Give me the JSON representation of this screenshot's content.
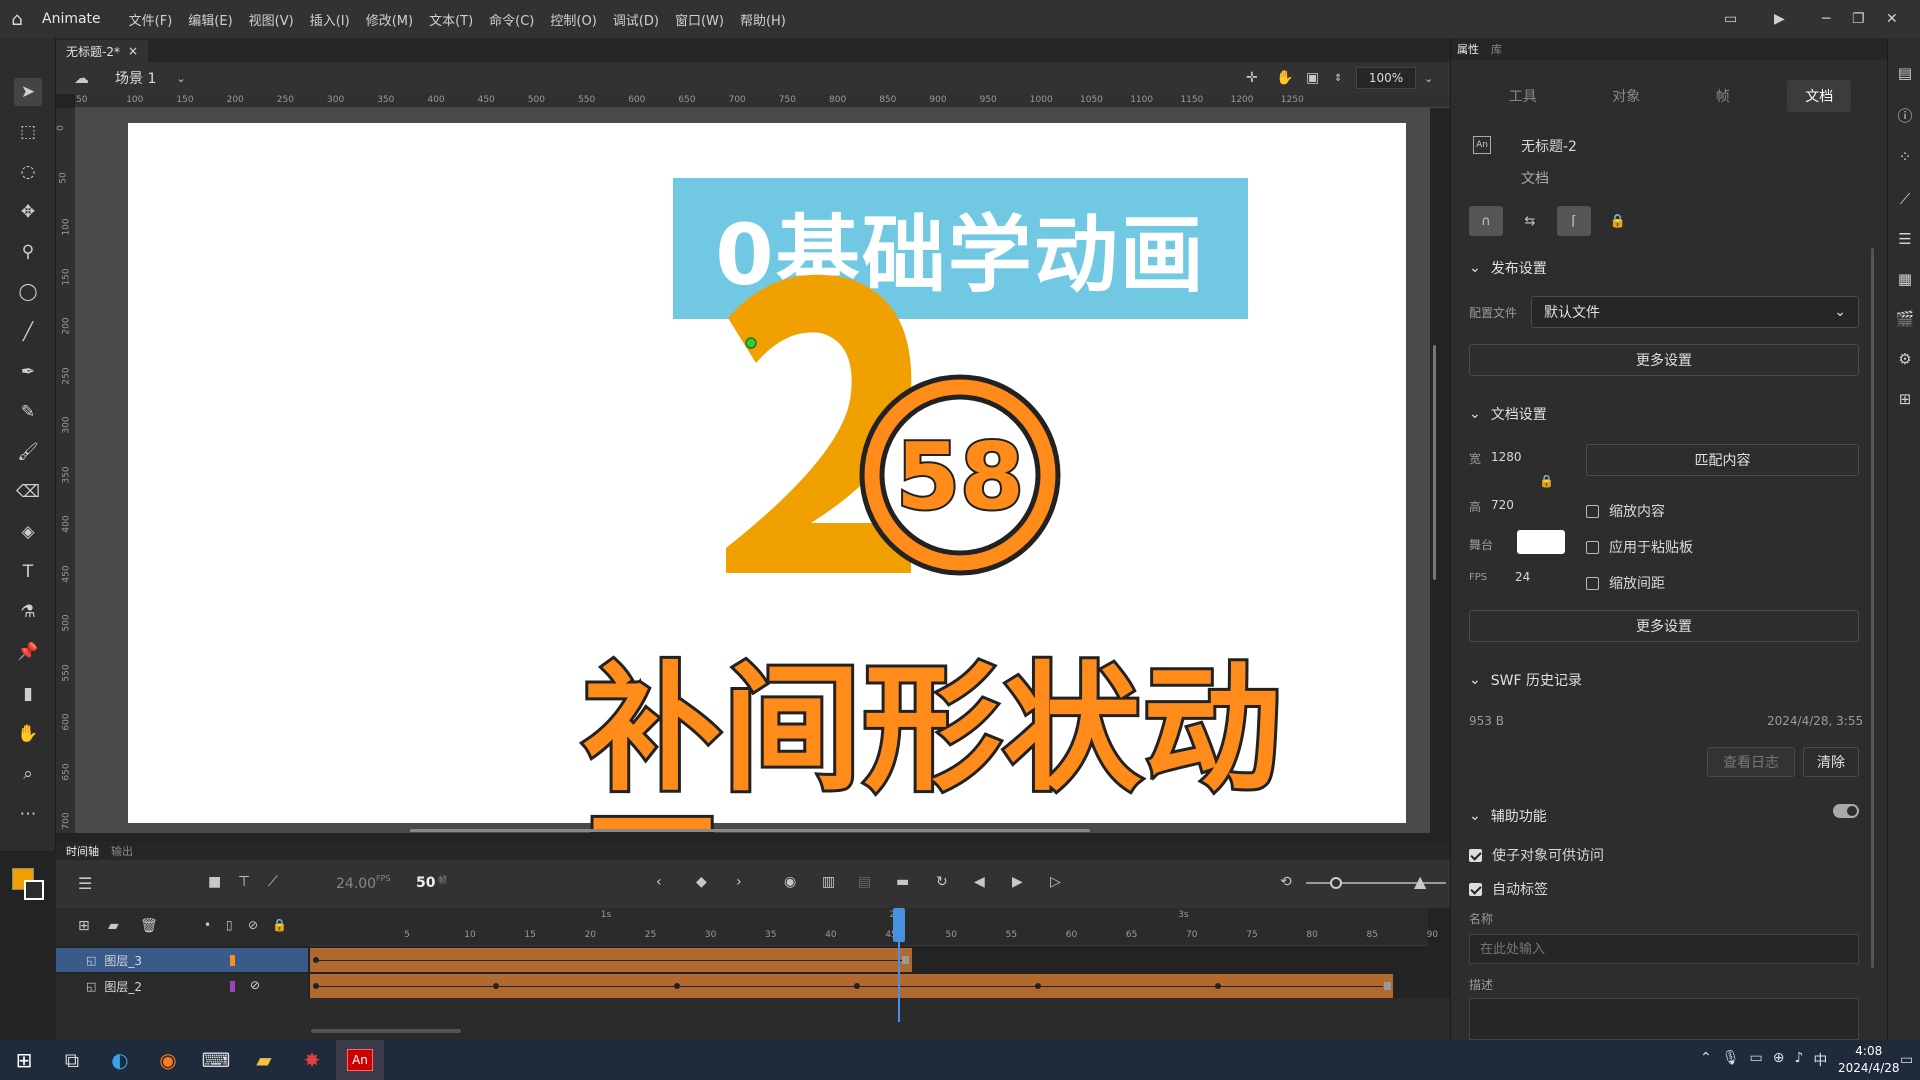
{
  "app": {
    "name": "Animate"
  },
  "menu": [
    "文件(F)",
    "编辑(E)",
    "视图(V)",
    "插入(I)",
    "修改(M)",
    "文本(T)",
    "命令(C)",
    "控制(O)",
    "调试(D)",
    "窗口(W)",
    "帮助(H)"
  ],
  "document": {
    "tab": "无标题-2*",
    "close": "×"
  },
  "scene": {
    "label": "场景 1",
    "zoom": "100%"
  },
  "ruler_ticks": [
    "50",
    "100",
    "150",
    "200",
    "250",
    "300",
    "350",
    "400",
    "450",
    "500",
    "550",
    "600",
    "650",
    "700",
    "750",
    "800",
    "850",
    "900",
    "950",
    "1000",
    "1050",
    "1100",
    "1150",
    "1200",
    "1250"
  ],
  "ruler_v_ticks": [
    "0",
    "50",
    "100",
    "150",
    "200",
    "250",
    "300",
    "350",
    "400",
    "450",
    "500",
    "550",
    "600",
    "650",
    "700"
  ],
  "stage": {
    "banner": "0基础学动画",
    "big_number": "2",
    "circle_number": "58",
    "bottom_text": "补间形状动画",
    "colors": {
      "banner_bg": "#70c8e3",
      "orange": "#f0a000",
      "bright_orange": "#ff8c1a"
    }
  },
  "timeline": {
    "tabs": [
      "时间轴",
      "输出"
    ],
    "fps": "24.00",
    "fps_unit": "FPS",
    "frame": "50",
    "frame_unit": "帧",
    "time_markers": [
      "1s",
      "2s",
      "3s"
    ],
    "frame_ticks": [
      "5",
      "10",
      "15",
      "20",
      "25",
      "30",
      "35",
      "40",
      "45",
      "50",
      "55",
      "60",
      "65",
      "70",
      "75",
      "80",
      "85",
      "90"
    ],
    "current_frame": 50,
    "total_frames_visible": 90,
    "layers": [
      {
        "name": "图层_3",
        "color": "#ff8c1a",
        "selected": true,
        "tween_end_frame": 50
      },
      {
        "name": "图层_2",
        "color": "#a040c0",
        "selected": false,
        "tween_end_frame": 90
      }
    ]
  },
  "properties": {
    "panel_tabs": [
      "属性",
      "库"
    ],
    "tabs": [
      "工具",
      "对象",
      "帧",
      "文档"
    ],
    "active_tab": "文档",
    "doc_name": "无标题-2",
    "doc_type": "文档",
    "publish": {
      "title": "发布设置",
      "profile_label": "配置文件",
      "profile_value": "默认文件",
      "more": "更多设置"
    },
    "doc_settings": {
      "title": "文档设置",
      "width_label": "宽",
      "width": "1280",
      "height_label": "高",
      "height": "720",
      "match": "匹配内容",
      "scale_content": "缩放内容",
      "apply_paste": "应用于粘贴板",
      "scale_spacing": "缩放间距",
      "stage_label": "舞台",
      "fps_label": "FPS",
      "fps": "24",
      "more": "更多设置"
    },
    "swf": {
      "title": "SWF 历史记录",
      "size": "953 B",
      "date": "2024/4/28, 3:55",
      "view_log": "查看日志",
      "clear": "清除"
    },
    "accessibility": {
      "title": "辅助功能",
      "make_accessible": "使子对象可供访问",
      "auto_label": "自动标签",
      "name_label": "名称",
      "name_placeholder": "在此处输入",
      "desc_label": "描述"
    }
  },
  "taskbar": {
    "time": "4:08",
    "date": "2024/4/28",
    "ime": "中"
  }
}
